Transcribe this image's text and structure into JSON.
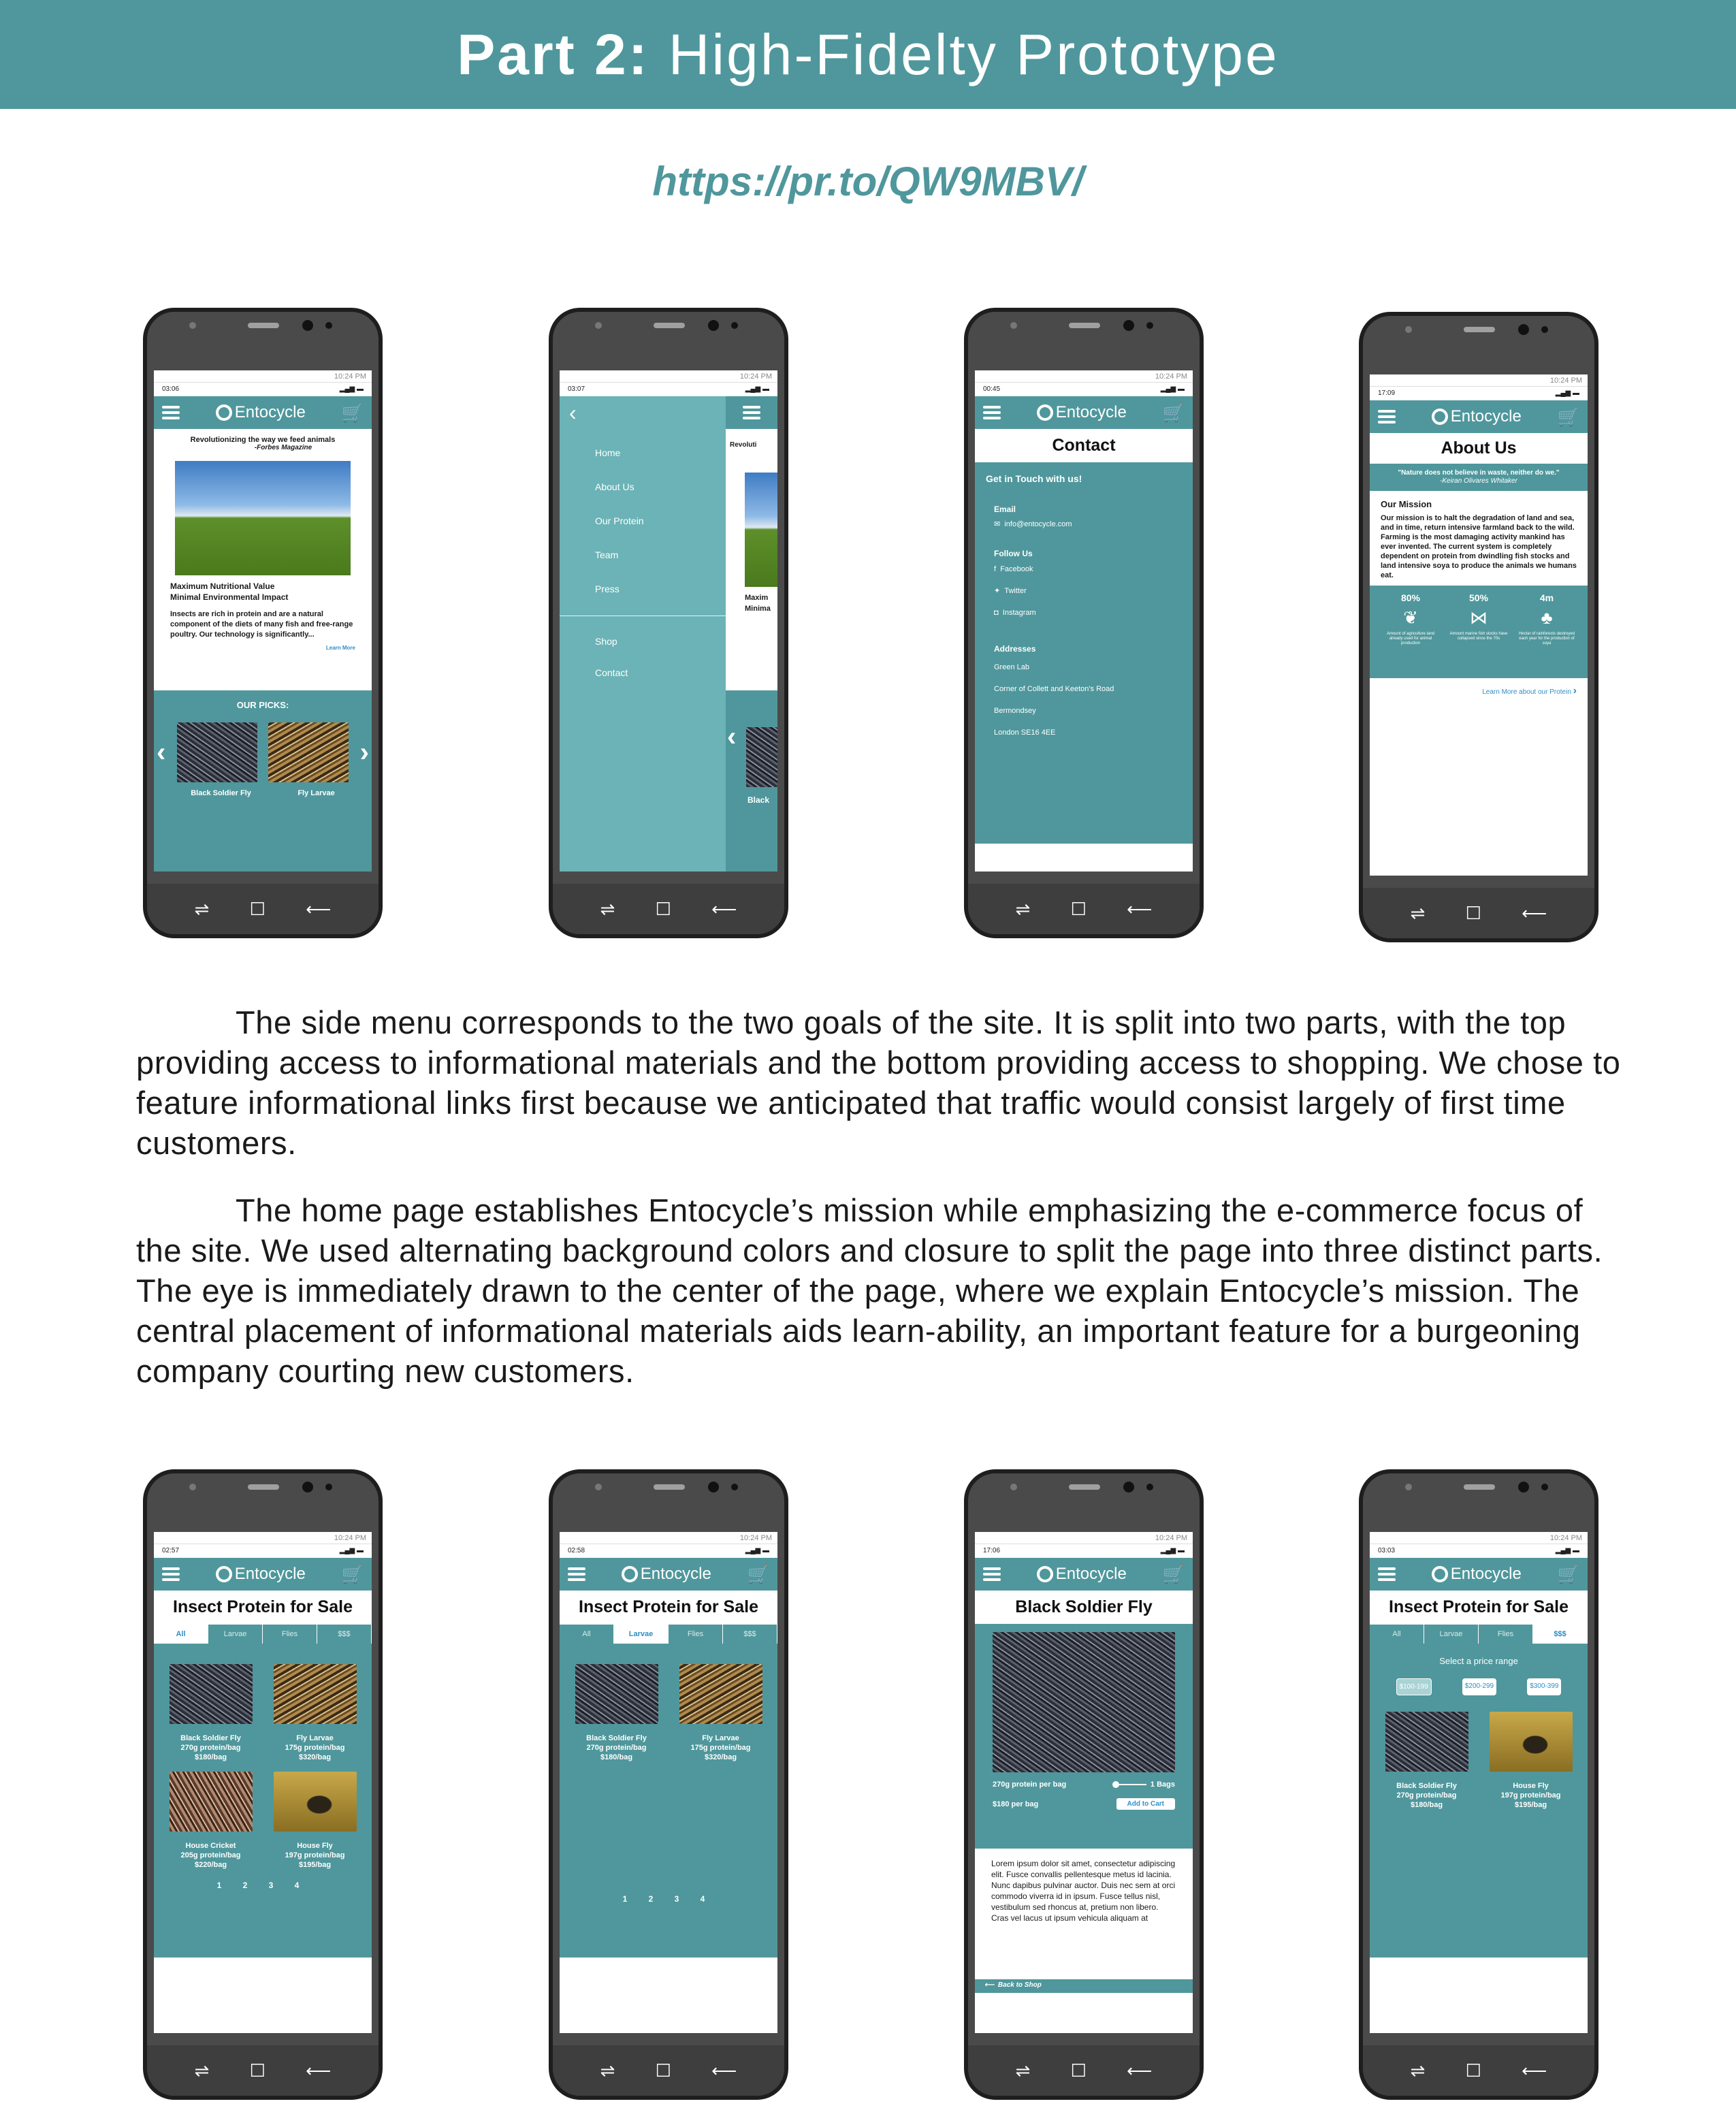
{
  "banner": {
    "bold": "Part 2:",
    "rest": "High-Fidelty Prototype"
  },
  "url": "https://pr.to/QW9MBV/",
  "paragraphs": [
    "The side menu corresponds to the two goals of the site. It is split into two parts, with the top providing access to informational materials and the bottom providing access to shopping. We chose to feature informational links first because we anticipated that traffic would consist largely of first time customers.",
    "The home page establishes Entocycle’s mission while emphasizing the e-commerce focus of the site. We used alternating background colors and closure to split the page into three distinct parts. The eye is immediately drawn to the center of the page, where we explain Entocycle’s mission. The central placement of informational materials aids learn-ability, an important feature for a burgeoning company courting new customers."
  ],
  "common": {
    "brand": "Entocycle",
    "os_status": "10:24 PM",
    "nav_buttons": [
      "⇌",
      "☐",
      "⟵"
    ]
  },
  "home": {
    "time": "03:06",
    "quote": "Revolutionizing the way we feed animals",
    "quote_source": "-Forbes Magazine",
    "heading1": "Maximum Nutritional Value",
    "heading2": "Minimal Environmental Impact",
    "body": "Insects are rich in protein and are a natural component of the diets of many fish and free-range poultry. Our technology is significantly...",
    "learn_more": "Learn More",
    "picks_title": "OUR PICKS:",
    "picks": [
      "Black Soldier Fly",
      "Fly Larvae"
    ]
  },
  "menu": {
    "time": "03:07",
    "top_items": [
      "Home",
      "About Us",
      "Our Protein",
      "Team",
      "Press"
    ],
    "bottom_items": [
      "Shop",
      "Contact"
    ],
    "peek_text": [
      "Revoluti",
      "Maxim",
      "Minima",
      "Black"
    ]
  },
  "contact": {
    "time": "00:45",
    "title": "Contact",
    "intro": "Get in Touch with us!",
    "email_label": "Email",
    "email": "info@entocycle.com",
    "follow_label": "Follow Us",
    "social": [
      "Facebook",
      "Twitter",
      "Instagram"
    ],
    "addresses_label": "Addresses",
    "address_lines": [
      "Green Lab",
      "Corner of Collett and Keeton's Road",
      "Bermondsey",
      "London SE16 4EE"
    ]
  },
  "about": {
    "time": "17:09",
    "title": "About Us",
    "quote": "\"Nature does not believe in waste, neither do we.\"",
    "quote_source": "-Keiran Olivares Whitaker",
    "mission_title": "Our Mission",
    "mission": "Our mission is to halt the degradation of land and sea, and in time, return intensive farmland back to the wild. Farming is the most damaging activity mankind has ever invented. The current system is completely dependent on protein from dwindling fish stocks and land intensive soya to produce the animals we humans eat.",
    "stats": [
      {
        "value": "80%",
        "caption": "Amount of agriculture land already used for animal production"
      },
      {
        "value": "50%",
        "caption": "Amount marine fish stocks have collapsed since the 70s"
      },
      {
        "value": "4m",
        "caption": "Hectar of rainforests destroyed each year for the production of soya"
      }
    ],
    "learn_more": "Learn More about our Protein"
  },
  "shop": {
    "title": "Insect Protein for Sale",
    "tabs": [
      "All",
      "Larvae",
      "Flies",
      "$$$"
    ],
    "shop_all_time": "02:57",
    "shop_larvae_time": "02:58",
    "shop_price_time": "03:03",
    "products": [
      {
        "name": "Black Soldier Fly",
        "protein": "270g protein/bag",
        "price": "$180/bag"
      },
      {
        "name": "Fly Larvae",
        "protein": "175g protein/bag",
        "price": "$320/bag"
      },
      {
        "name": "House Cricket",
        "protein": "205g protein/bag",
        "price": "$220/bag"
      },
      {
        "name": "House Fly",
        "protein": "197g protein/bag",
        "price": "$195/bag"
      }
    ],
    "pages": "1 2 3 4",
    "price_prompt": "Select a price range",
    "price_ranges": [
      "$100-199",
      "$200-299",
      "$300-399"
    ]
  },
  "detail": {
    "time": "17:06",
    "title": "Black Soldier Fly",
    "protein_label": "270g protein per bag",
    "qty": "1 Bags",
    "price": "$180 per bag",
    "add_to_cart": "Add to Cart",
    "lorem": "Lorem ipsum dolor sit amet, consectetur adipiscing elit. Fusce convallis pellentesque metus id lacinia. Nunc dapibus pulvinar auctor. Duis nec sem at orci commodo viverra id in ipsum. Fusce tellus nisl, vestibulum sed rhoncus at, pretium non libero. Cras vel lacus ut ipsum vehicula aliquam at",
    "back": "Back to Shop"
  },
  "colors": {
    "teal": "#4f979c",
    "link": "#2d8fc7",
    "frame": "#4a4a4a"
  }
}
